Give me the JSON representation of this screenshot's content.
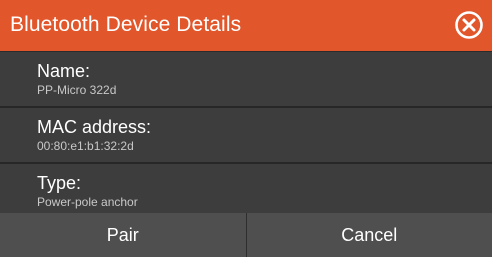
{
  "dialog": {
    "title": "Bluetooth Device Details",
    "close_icon": "close-circle-icon",
    "accent_color": "#e1562a"
  },
  "details": [
    {
      "label": "Name:",
      "value": "PP-Micro 322d"
    },
    {
      "label": "MAC address:",
      "value": "00:80:e1:b1:32:2d"
    },
    {
      "label": "Type:",
      "value": "Power-pole anchor"
    }
  ],
  "buttons": {
    "pair": "Pair",
    "cancel": "Cancel"
  }
}
